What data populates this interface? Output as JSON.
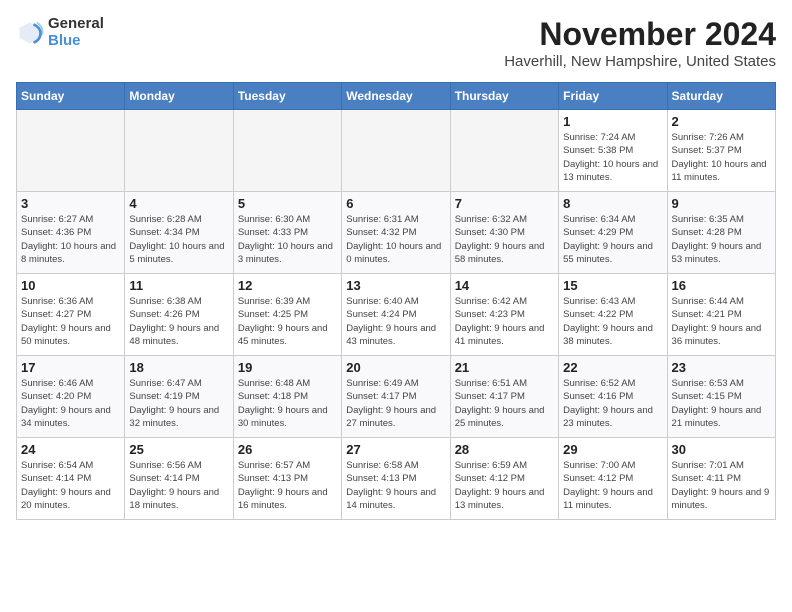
{
  "header": {
    "logo_line1": "General",
    "logo_line2": "Blue",
    "month": "November 2024",
    "location": "Haverhill, New Hampshire, United States"
  },
  "weekdays": [
    "Sunday",
    "Monday",
    "Tuesday",
    "Wednesday",
    "Thursday",
    "Friday",
    "Saturday"
  ],
  "weeks": [
    [
      {
        "day": "",
        "info": ""
      },
      {
        "day": "",
        "info": ""
      },
      {
        "day": "",
        "info": ""
      },
      {
        "day": "",
        "info": ""
      },
      {
        "day": "",
        "info": ""
      },
      {
        "day": "1",
        "info": "Sunrise: 7:24 AM\nSunset: 5:38 PM\nDaylight: 10 hours and 13 minutes."
      },
      {
        "day": "2",
        "info": "Sunrise: 7:26 AM\nSunset: 5:37 PM\nDaylight: 10 hours and 11 minutes."
      }
    ],
    [
      {
        "day": "3",
        "info": "Sunrise: 6:27 AM\nSunset: 4:36 PM\nDaylight: 10 hours and 8 minutes."
      },
      {
        "day": "4",
        "info": "Sunrise: 6:28 AM\nSunset: 4:34 PM\nDaylight: 10 hours and 5 minutes."
      },
      {
        "day": "5",
        "info": "Sunrise: 6:30 AM\nSunset: 4:33 PM\nDaylight: 10 hours and 3 minutes."
      },
      {
        "day": "6",
        "info": "Sunrise: 6:31 AM\nSunset: 4:32 PM\nDaylight: 10 hours and 0 minutes."
      },
      {
        "day": "7",
        "info": "Sunrise: 6:32 AM\nSunset: 4:30 PM\nDaylight: 9 hours and 58 minutes."
      },
      {
        "day": "8",
        "info": "Sunrise: 6:34 AM\nSunset: 4:29 PM\nDaylight: 9 hours and 55 minutes."
      },
      {
        "day": "9",
        "info": "Sunrise: 6:35 AM\nSunset: 4:28 PM\nDaylight: 9 hours and 53 minutes."
      }
    ],
    [
      {
        "day": "10",
        "info": "Sunrise: 6:36 AM\nSunset: 4:27 PM\nDaylight: 9 hours and 50 minutes."
      },
      {
        "day": "11",
        "info": "Sunrise: 6:38 AM\nSunset: 4:26 PM\nDaylight: 9 hours and 48 minutes."
      },
      {
        "day": "12",
        "info": "Sunrise: 6:39 AM\nSunset: 4:25 PM\nDaylight: 9 hours and 45 minutes."
      },
      {
        "day": "13",
        "info": "Sunrise: 6:40 AM\nSunset: 4:24 PM\nDaylight: 9 hours and 43 minutes."
      },
      {
        "day": "14",
        "info": "Sunrise: 6:42 AM\nSunset: 4:23 PM\nDaylight: 9 hours and 41 minutes."
      },
      {
        "day": "15",
        "info": "Sunrise: 6:43 AM\nSunset: 4:22 PM\nDaylight: 9 hours and 38 minutes."
      },
      {
        "day": "16",
        "info": "Sunrise: 6:44 AM\nSunset: 4:21 PM\nDaylight: 9 hours and 36 minutes."
      }
    ],
    [
      {
        "day": "17",
        "info": "Sunrise: 6:46 AM\nSunset: 4:20 PM\nDaylight: 9 hours and 34 minutes."
      },
      {
        "day": "18",
        "info": "Sunrise: 6:47 AM\nSunset: 4:19 PM\nDaylight: 9 hours and 32 minutes."
      },
      {
        "day": "19",
        "info": "Sunrise: 6:48 AM\nSunset: 4:18 PM\nDaylight: 9 hours and 30 minutes."
      },
      {
        "day": "20",
        "info": "Sunrise: 6:49 AM\nSunset: 4:17 PM\nDaylight: 9 hours and 27 minutes."
      },
      {
        "day": "21",
        "info": "Sunrise: 6:51 AM\nSunset: 4:17 PM\nDaylight: 9 hours and 25 minutes."
      },
      {
        "day": "22",
        "info": "Sunrise: 6:52 AM\nSunset: 4:16 PM\nDaylight: 9 hours and 23 minutes."
      },
      {
        "day": "23",
        "info": "Sunrise: 6:53 AM\nSunset: 4:15 PM\nDaylight: 9 hours and 21 minutes."
      }
    ],
    [
      {
        "day": "24",
        "info": "Sunrise: 6:54 AM\nSunset: 4:14 PM\nDaylight: 9 hours and 20 minutes."
      },
      {
        "day": "25",
        "info": "Sunrise: 6:56 AM\nSunset: 4:14 PM\nDaylight: 9 hours and 18 minutes."
      },
      {
        "day": "26",
        "info": "Sunrise: 6:57 AM\nSunset: 4:13 PM\nDaylight: 9 hours and 16 minutes."
      },
      {
        "day": "27",
        "info": "Sunrise: 6:58 AM\nSunset: 4:13 PM\nDaylight: 9 hours and 14 minutes."
      },
      {
        "day": "28",
        "info": "Sunrise: 6:59 AM\nSunset: 4:12 PM\nDaylight: 9 hours and 13 minutes."
      },
      {
        "day": "29",
        "info": "Sunrise: 7:00 AM\nSunset: 4:12 PM\nDaylight: 9 hours and 11 minutes."
      },
      {
        "day": "30",
        "info": "Sunrise: 7:01 AM\nSunset: 4:11 PM\nDaylight: 9 hours and 9 minutes."
      }
    ]
  ]
}
